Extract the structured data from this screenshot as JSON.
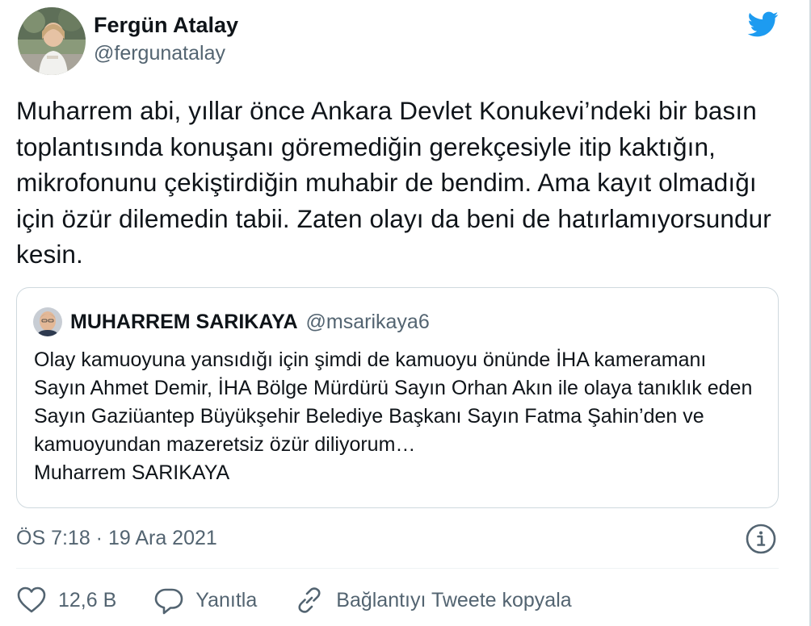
{
  "author": {
    "display_name": "Fergün Atalay",
    "handle": "@fergunatalay"
  },
  "tweet": {
    "text": "Muharrem abi, yıllar önce Ankara Devlet Konukevi’ndeki bir basın toplantısında konuşanı göremediğin gerekçesiyle itip kaktığın, mikrofonunu çekiştirdiğin muhabir de bendim. Ama kayıt olmadığı için özür dilemedin tabii. Zaten olayı da beni de hatırlamıyorsundur kesin."
  },
  "quoted": {
    "display_name": "MUHARREM SARIKAYA",
    "handle": "@msarikaya6",
    "text": "Olay kamuoyuna yansıdığı için şimdi de kamuoyu önünde İHA kameramanı Sayın Ahmet Demir, İHA Bölge Mürdürü Sayın Orhan Akın ile olaya tanıklık eden Sayın Gaziüantep Büyükşehir Belediye Başkanı Sayın Fatma Şahin’den ve kamuoyundan  mazeretsiz özür diliyorum…\nMuharrem SARIKAYA"
  },
  "timestamp": "ÖS 7:18 · 19 Ara 2021",
  "actions": {
    "like_count": "12,6 B",
    "reply_label": "Yanıtla",
    "copy_link_label": "Bağlantıyı Tweete kopyala"
  },
  "icons": {
    "brand": "twitter-bird-icon",
    "info": "info-icon",
    "like": "heart-icon",
    "reply": "reply-bubble-icon",
    "copy_link": "link-icon"
  },
  "colors": {
    "brand_blue": "#1d9bf0",
    "text_primary": "#0f1419",
    "text_secondary": "#536471",
    "border": "#cfd9de"
  }
}
